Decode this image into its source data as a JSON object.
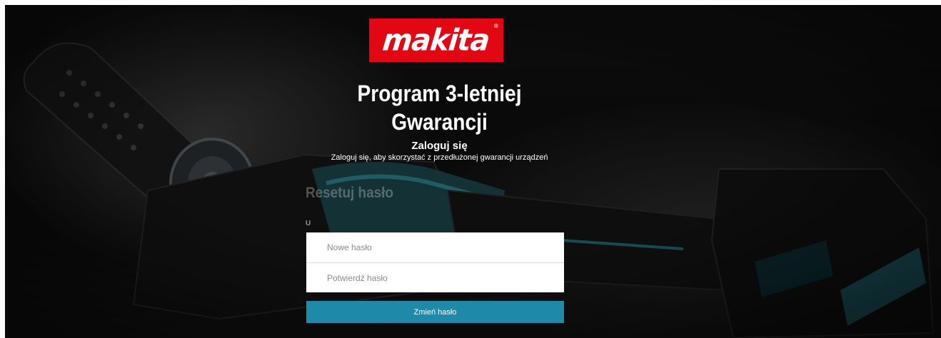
{
  "brand": {
    "logo_text": "makita",
    "logo_mark": "®",
    "colors": {
      "logo_red": "#e30613",
      "button_teal": "#1e89a8"
    }
  },
  "header": {
    "title": "Program 3-letniej Gwarancji",
    "login_heading": "Zaloguj się",
    "login_subtitle": "Zaloguj się, aby skorzystać z przedłużonej gwarancji urządzeń"
  },
  "reset_form": {
    "heading": "Resetuj hasło",
    "small_mark": "U",
    "new_password": {
      "placeholder": "Nowe hasło",
      "value": ""
    },
    "confirm_password": {
      "placeholder": "Potwierdź hasło",
      "value": ""
    },
    "submit_label": "Zmień hasło"
  }
}
